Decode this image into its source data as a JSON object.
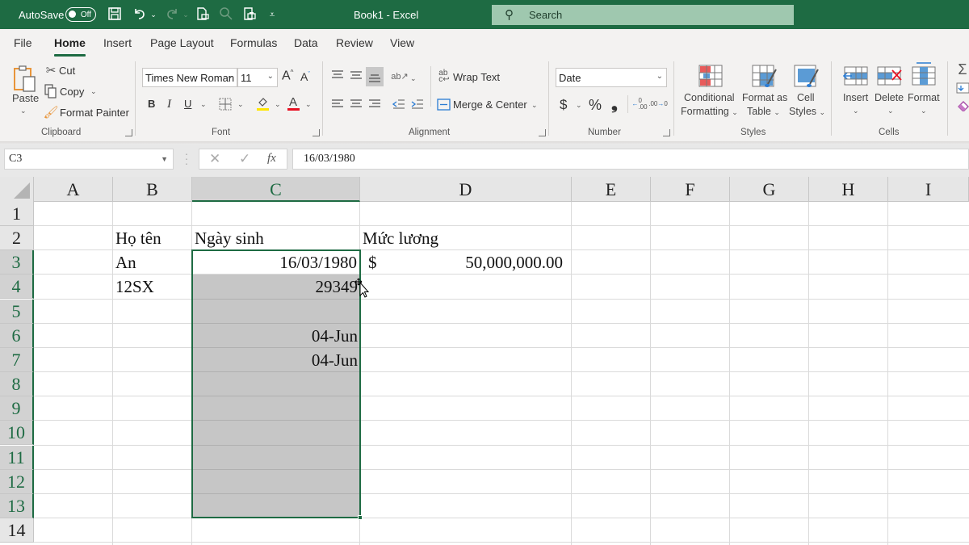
{
  "titlebar": {
    "autosave_label": "AutoSave",
    "autosave_state": "Off",
    "title": "Book1  -  Excel",
    "search_placeholder": "Search",
    "quick_access": [
      "save-icon",
      "undo-icon",
      "redo-icon",
      "print-preview-icon",
      "find-icon",
      "print-icon",
      "customize-qat-icon"
    ]
  },
  "tabs": [
    {
      "label": "File",
      "active": false
    },
    {
      "label": "Home",
      "active": true
    },
    {
      "label": "Insert",
      "active": false
    },
    {
      "label": "Page Layout",
      "active": false
    },
    {
      "label": "Formulas",
      "active": false
    },
    {
      "label": "Data",
      "active": false
    },
    {
      "label": "Review",
      "active": false
    },
    {
      "label": "View",
      "active": false
    }
  ],
  "ribbon": {
    "clipboard": {
      "label": "Clipboard",
      "paste": "Paste",
      "cut": "Cut",
      "copy": "Copy",
      "format_painter": "Format Painter"
    },
    "font": {
      "label": "Font",
      "font_name": "Times New Roman",
      "font_size": "11",
      "bold": "B",
      "italic": "I",
      "underline": "U",
      "fill_color": "#ffe600",
      "font_color": "#e81123"
    },
    "alignment": {
      "label": "Alignment",
      "wrap_text": "Wrap Text",
      "merge_center": "Merge & Center"
    },
    "number": {
      "label": "Number",
      "format": "Date",
      "currency": "$",
      "percent": "%",
      "comma": "❟"
    },
    "styles": {
      "label": "Styles",
      "conditional_formatting": [
        "Conditional",
        "Formatting"
      ],
      "format_as_table": [
        "Format as",
        "Table"
      ],
      "cell_styles": [
        "Cell",
        "Styles"
      ]
    },
    "cells": {
      "label": "Cells",
      "insert": "Insert",
      "delete": "Delete",
      "format": "Format"
    }
  },
  "formula_bar": {
    "name_box": "C3",
    "cancel": "✕",
    "enter": "✓",
    "fx": "fx",
    "value": "16/03/1980"
  },
  "sheet": {
    "columns": [
      "A",
      "B",
      "C",
      "D",
      "E",
      "F",
      "G",
      "H",
      "I"
    ],
    "selected_column": "C",
    "rows": [
      "1",
      "2",
      "3",
      "4",
      "5",
      "6",
      "7",
      "8",
      "9",
      "10",
      "11",
      "12",
      "13",
      "14"
    ],
    "selected_range": "C3:C13",
    "active_cell": "C3",
    "cells": {
      "B2": "Họ tên",
      "C2": "Ngày sinh",
      "D2": "Mức lương",
      "B3": "An",
      "C3": "16/03/1980",
      "D3_symbol": "$",
      "D3_value": "50,000,000.00",
      "B4": "12SX",
      "C4": "29349",
      "C6": "04-Jun",
      "C7": "04-Jun"
    }
  },
  "colors": {
    "brand_green": "#1e6b43",
    "selection_fill": "#c6c6c6"
  }
}
